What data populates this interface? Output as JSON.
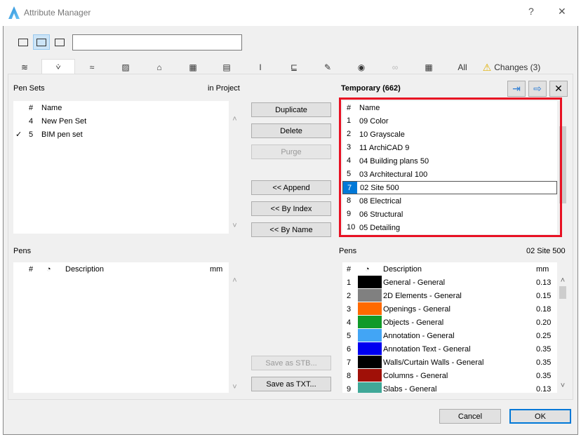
{
  "window": {
    "title": "Attribute Manager",
    "help": "?",
    "close": "✕"
  },
  "tabs": {
    "icons": [
      "layers-icon",
      "pen-icon",
      "line-type-icon",
      "fill-icon",
      "surface-icon",
      "composite-icon",
      "profile-icon",
      "building-material-icon",
      "zone-icon",
      "markup-icon",
      "mep-icon",
      "link-icon",
      "table-icon"
    ],
    "all": "All",
    "changes": "Changes (3)"
  },
  "left": {
    "pen_sets_label": "Pen Sets",
    "in_project": "in Project",
    "pen_sets_header": {
      "num": "#",
      "name": "Name"
    },
    "pen_sets": [
      {
        "num": "4",
        "name": "New Pen Set",
        "checked": false
      },
      {
        "num": "5",
        "name": "BIM pen set",
        "checked": true
      }
    ],
    "pens_label": "Pens",
    "pens_header": {
      "num": "#",
      "desc": "Description",
      "mm": "mm"
    }
  },
  "middle": {
    "duplicate": "Duplicate",
    "delete": "Delete",
    "purge": "Purge",
    "append": "<< Append",
    "by_index": "<< By Index",
    "by_name": "<< By Name",
    "save_stb": "Save as STB...",
    "save_txt": "Save as TXT..."
  },
  "right": {
    "title": "Temporary (662)",
    "sets_header": {
      "num": "#",
      "name": "Name"
    },
    "pen_sets": [
      {
        "num": "1",
        "name": "09 Color"
      },
      {
        "num": "2",
        "name": "10 Grayscale"
      },
      {
        "num": "3",
        "name": "11 ArchiCAD 9"
      },
      {
        "num": "4",
        "name": "04 Building plans 50"
      },
      {
        "num": "5",
        "name": "03 Architectural 100"
      },
      {
        "num": "7",
        "name": "02 Site 500",
        "selected": true
      },
      {
        "num": "8",
        "name": "08 Electrical"
      },
      {
        "num": "9",
        "name": "06 Structural"
      },
      {
        "num": "10",
        "name": "05 Detailing"
      }
    ],
    "pens_label": "Pens",
    "selected_set": "02 Site 500",
    "pens_header": {
      "num": "#",
      "desc": "Description",
      "mm": "mm"
    },
    "pens": [
      {
        "num": "1",
        "color": "#000000",
        "desc": "General - General",
        "mm": "0.13"
      },
      {
        "num": "2",
        "color": "#808080",
        "desc": "2D Elements - General",
        "mm": "0.15"
      },
      {
        "num": "3",
        "color": "#ff6a00",
        "desc": "Openings - General",
        "mm": "0.18"
      },
      {
        "num": "4",
        "color": "#109a28",
        "desc": "Objects - General",
        "mm": "0.20"
      },
      {
        "num": "5",
        "color": "#42a5f5",
        "desc": "Annotation - General",
        "mm": "0.25"
      },
      {
        "num": "6",
        "color": "#0000f0",
        "desc": "Annotation Text  - General",
        "mm": "0.35"
      },
      {
        "num": "7",
        "color": "#000000",
        "desc": "Walls/Curtain Walls - General",
        "mm": "0.35"
      },
      {
        "num": "8",
        "color": "#a01008",
        "desc": "Columns - General",
        "mm": "0.35"
      },
      {
        "num": "9",
        "color": "#40a898",
        "desc": "Slabs - General",
        "mm": "0.13"
      }
    ]
  },
  "footer": {
    "cancel": "Cancel",
    "ok": "OK"
  },
  "colors": {
    "highlight": "#e81123",
    "selection": "#0078d7"
  }
}
